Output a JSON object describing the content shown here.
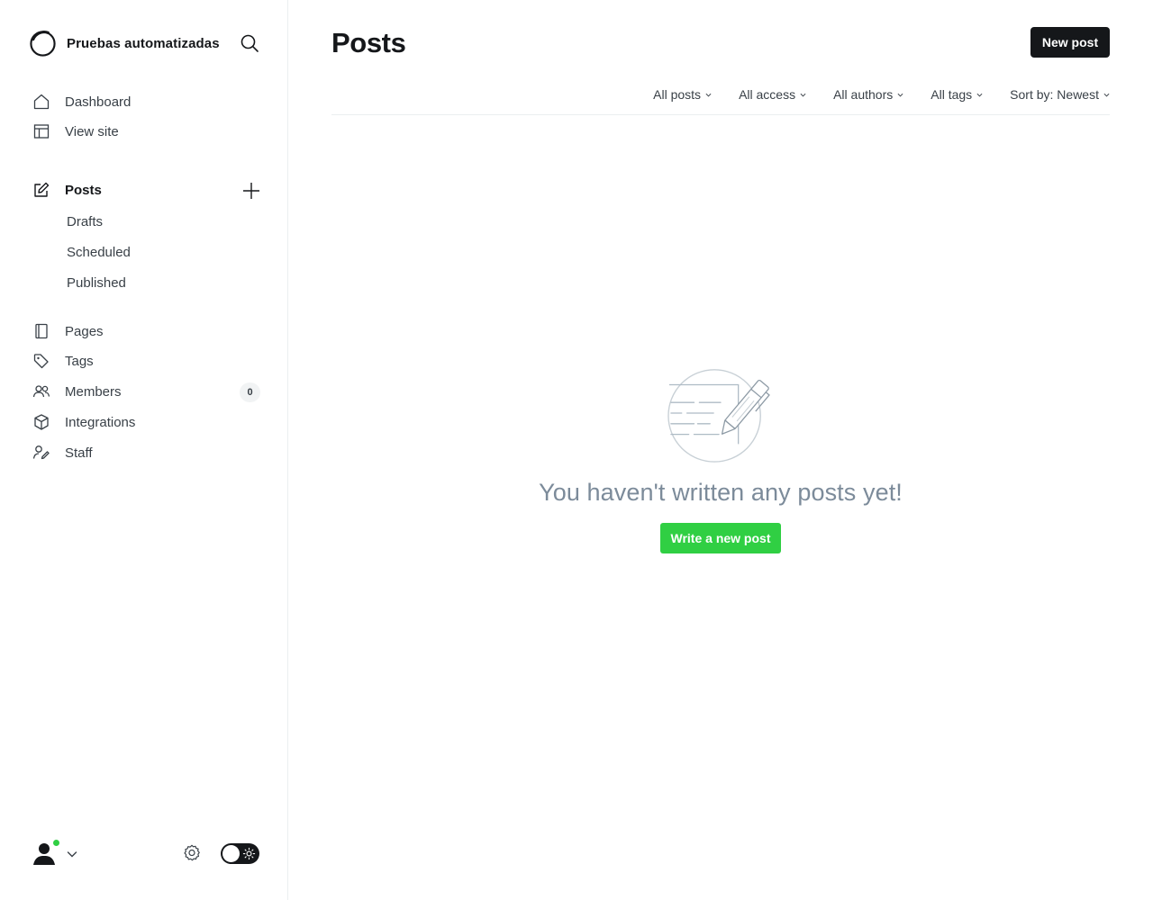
{
  "site": {
    "name": "Pruebas automatizadas"
  },
  "nav": {
    "dashboard": "Dashboard",
    "view_site": "View site",
    "posts": "Posts",
    "drafts": "Drafts",
    "scheduled": "Scheduled",
    "published": "Published",
    "pages": "Pages",
    "tags": "Tags",
    "members": "Members",
    "members_count": "0",
    "integrations": "Integrations",
    "staff": "Staff"
  },
  "header": {
    "title": "Posts",
    "new_post_label": "New post"
  },
  "filters": {
    "type": "All posts",
    "access": "All access",
    "authors": "All authors",
    "tags": "All tags",
    "sort": "Sort by: Newest"
  },
  "empty_state": {
    "message": "You haven't written any posts yet!",
    "cta_label": "Write a new post"
  },
  "icons": {
    "search": "search-icon",
    "dashboard": "home-icon",
    "view_site": "layout-icon",
    "posts": "edit-icon",
    "add": "plus-icon",
    "pages": "page-icon",
    "tags": "tag-icon",
    "members": "members-icon",
    "integrations": "cube-icon",
    "staff": "staff-icon",
    "settings": "gear-icon",
    "theme": "sun-icon"
  },
  "colors": {
    "primary_dark": "#15171a",
    "accent_green": "#30cf43",
    "status_online": "#30cf43",
    "muted_text": "#7c8b9a"
  }
}
